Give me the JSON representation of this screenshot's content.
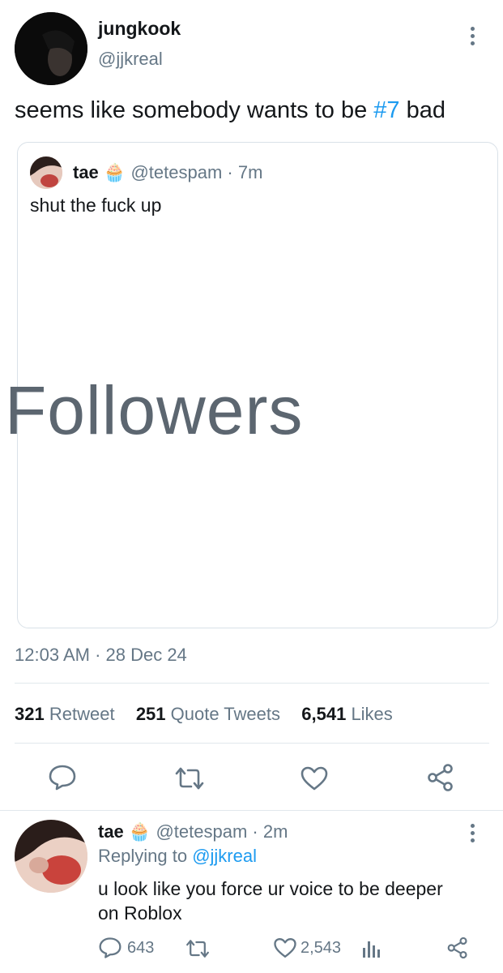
{
  "tweet": {
    "author": {
      "display_name": "jungkook",
      "handle": "@jjkreal"
    },
    "text_before": "seems like somebody wants to be ",
    "hashtag": "#7",
    "text_after": " bad",
    "timestamp": "12:03 AM · 28 Dec 24",
    "stats": {
      "retweets": "321",
      "retweets_label": "Retweet",
      "quotes": "251",
      "quotes_label": "Quote Tweets",
      "likes": "6,541",
      "likes_label": "Likes"
    }
  },
  "quoted_tweet": {
    "display_name": "tae",
    "emoji": "🧁",
    "handle": "@tetespam",
    "time": "· 7m",
    "text": "shut the fuck up",
    "image_text": "Followers"
  },
  "reply": {
    "display_name": "tae",
    "emoji": "🧁",
    "handle": "@tetespam",
    "time": "· 2m",
    "replying_prefix": "Replying to ",
    "replying_handle": "@jjkreal",
    "text_line1": "u look like you force ur voice to be deeper",
    "text_line2": "on Roblox",
    "reply_count": "643",
    "like_count": "2,543"
  },
  "colors": {
    "accent": "#1d9bf0",
    "muted": "#657786",
    "border": "#e1e8ed"
  },
  "icons": [
    "more-icon",
    "reply-icon",
    "retweet-icon",
    "like-icon",
    "share-icon",
    "analytics-icon"
  ]
}
